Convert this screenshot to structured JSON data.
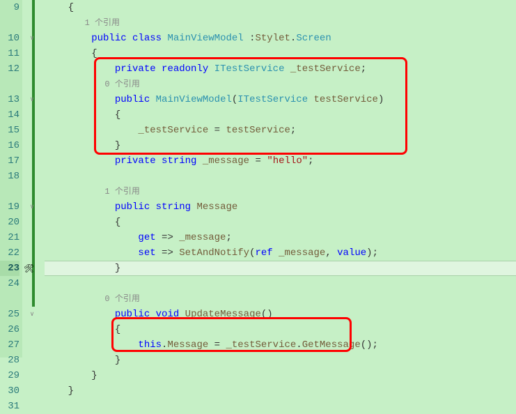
{
  "lines": {
    "9": {
      "num": "9"
    },
    "10": {
      "num": "10"
    },
    "11": {
      "num": "11"
    },
    "12": {
      "num": "12"
    },
    "13": {
      "num": "13"
    },
    "14": {
      "num": "14"
    },
    "15": {
      "num": "15"
    },
    "16": {
      "num": "16"
    },
    "17": {
      "num": "17"
    },
    "18": {
      "num": "18"
    },
    "19": {
      "num": "19"
    },
    "20": {
      "num": "20"
    },
    "21": {
      "num": "21"
    },
    "22": {
      "num": "22"
    },
    "23": {
      "num": "23"
    },
    "24": {
      "num": "24"
    },
    "25": {
      "num": "25"
    },
    "26": {
      "num": "26"
    },
    "27": {
      "num": "27"
    },
    "28": {
      "num": "28"
    },
    "29": {
      "num": "29"
    },
    "30": {
      "num": "30"
    },
    "31": {
      "num": "31"
    }
  },
  "codelens": {
    "ref1": "1 个引用",
    "ref0a": "0 个引用",
    "ref1b": "1 个引用",
    "ref0b": "0 个引用"
  },
  "tok": {
    "lbrace": "{",
    "rbrace": "}",
    "public": "public",
    "class": "class",
    "MainViewModel": "MainViewModel",
    "colon": " :",
    "Stylet": "Stylet",
    "dot": ".",
    "Screen": "Screen",
    "private": "private",
    "readonly": "readonly",
    "ITestService": "ITestService",
    "_testService": " _testService",
    "semi": ";",
    "MainViewModelCtor": "MainViewModel",
    "lparen": "(",
    "rparen": ")",
    "testServiceParam": " testService",
    "_testServiceAssign": "_testService",
    "eq": " = ",
    "testService": "testService",
    "string": "string",
    "_message": " _message",
    "eq2": " = ",
    "hello": "\"hello\"",
    "Message": " Message",
    "get": "get",
    "arrow": " => ",
    "_messageRef": "_message",
    "set": "set",
    "SetAndNotify": "SetAndNotify",
    "ref": "ref",
    "_messageRef2": " _message",
    "comma": ", ",
    "value": "value",
    "void": "void",
    "UpdateMessage": " UpdateMessage",
    "this": "this",
    "MessageProp": "Message",
    "_testServiceRef": "_testService",
    "GetMessage": "GetMessage",
    "emptyparens": "()"
  },
  "icons": {
    "screwdriver": "🛠"
  }
}
